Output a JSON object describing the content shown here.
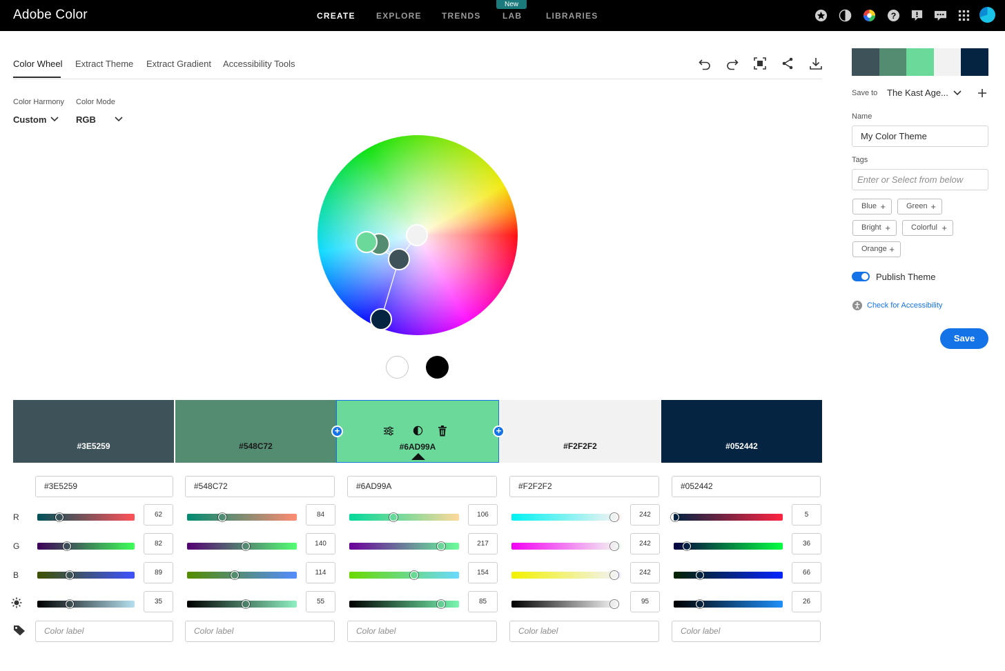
{
  "app": {
    "title": "Adobe Color"
  },
  "nav": {
    "items": [
      "CREATE",
      "EXPLORE",
      "TRENDS",
      "LAB",
      "LIBRARIES"
    ],
    "badge": "New"
  },
  "tabs": [
    "Color Wheel",
    "Extract Theme",
    "Extract Gradient",
    "Accessibility Tools"
  ],
  "controls": {
    "harmony_label": "Color Harmony",
    "harmony_value": "Custom",
    "mode_label": "Color Mode",
    "mode_value": "RGB"
  },
  "swatches": [
    {
      "hex": "#3E5259",
      "r": "62",
      "g": "82",
      "b": "89",
      "bright": "35",
      "label_placeholder": "Color label",
      "color": "#3E5259",
      "text_color": "#ffffff"
    },
    {
      "hex": "#548C72",
      "r": "84",
      "g": "140",
      "b": "114",
      "bright": "55",
      "label_placeholder": "Color label",
      "color": "#548C72",
      "text_color": "#1a1a1a"
    },
    {
      "hex": "#6AD99A",
      "r": "106",
      "g": "217",
      "b": "154",
      "bright": "85",
      "label_placeholder": "Color label",
      "color": "#6AD99A",
      "text_color": "#1a1a1a"
    },
    {
      "hex": "#F2F2F2",
      "r": "242",
      "g": "242",
      "b": "242",
      "bright": "95",
      "label_placeholder": "Color label",
      "color": "#F2F2F2",
      "text_color": "#1a1a1a"
    },
    {
      "hex": "#052442",
      "r": "5",
      "g": "36",
      "b": "66",
      "bright": "26",
      "label_placeholder": "Color label",
      "color": "#052442",
      "text_color": "#ffffff"
    }
  ],
  "row_labels": {
    "r": "R",
    "g": "G",
    "b": "B"
  },
  "panel": {
    "save_to_label": "Save to",
    "save_to_value": "The Kast Age...",
    "name_label": "Name",
    "name_value": "My Color Theme",
    "tags_label": "Tags",
    "tags_placeholder": "Enter or Select from below",
    "tags": [
      "Blue",
      "Green",
      "Bright",
      "Colorful",
      "Orange"
    ],
    "publish_label": "Publish Theme",
    "publish_on": true,
    "accessibility_link": "Check for Accessibility",
    "save_button": "Save"
  },
  "colors": {
    "accent": "#1473e6",
    "topbar": "#000000",
    "lab_badge": "#1b7a7c"
  }
}
